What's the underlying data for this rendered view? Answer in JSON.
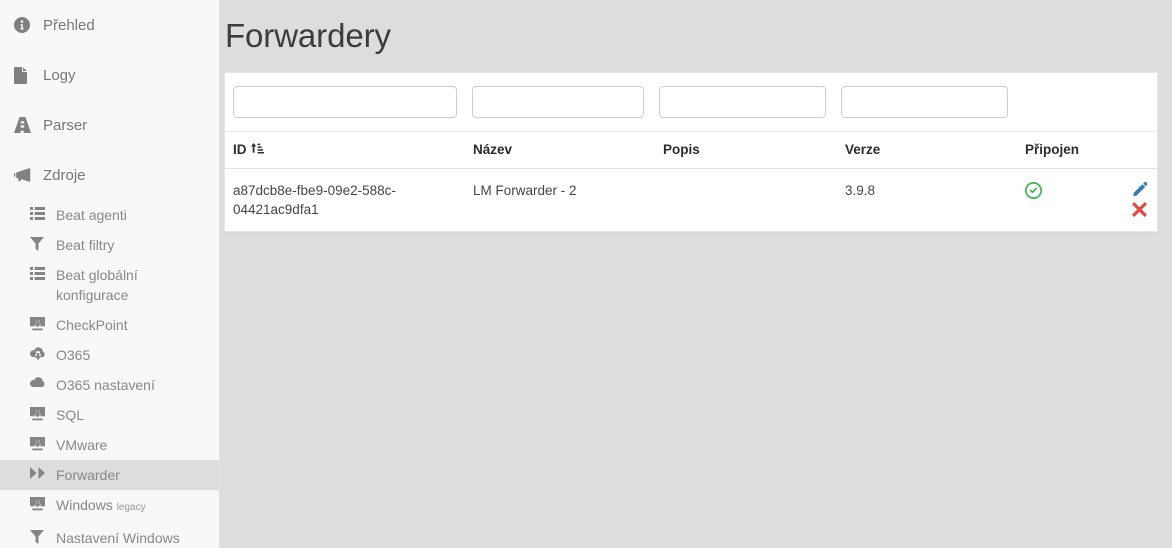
{
  "theme": {
    "page_bg": "#dddddd",
    "sidebar_bg": "#f8f8f8",
    "card_bg": "#ffffff",
    "active_item_bg": "#dddddd",
    "accent_edit": "#337ab7",
    "accent_delete": "#e8453c",
    "accent_connected": "#3ab54a",
    "title_color": "#3c3c3c"
  },
  "sidebar": {
    "top_items": [
      {
        "label": "Přehled",
        "icon": "info-circle-icon",
        "active": false
      },
      {
        "label": "Logy",
        "icon": "file-icon",
        "active": false
      },
      {
        "label": "Parser",
        "icon": "road-icon",
        "active": false
      },
      {
        "label": "Zdroje",
        "icon": "bullhorn-icon",
        "active": true
      }
    ],
    "sub_items": [
      {
        "label": "Beat agenti",
        "icon": "list-icon",
        "active": false,
        "sup": ""
      },
      {
        "label": "Beat filtry",
        "icon": "filter-icon",
        "active": false,
        "sup": ""
      },
      {
        "label": "Beat globální konfigurace",
        "icon": "list-icon",
        "active": false,
        "sup": ""
      },
      {
        "label": "CheckPoint",
        "icon": "desktop-download-icon",
        "active": false,
        "sup": ""
      },
      {
        "label": "O365",
        "icon": "cloud-download-icon",
        "active": false,
        "sup": ""
      },
      {
        "label": "O365 nastavení",
        "icon": "cloud-icon",
        "active": false,
        "sup": ""
      },
      {
        "label": "SQL",
        "icon": "desktop-download-icon",
        "active": false,
        "sup": ""
      },
      {
        "label": "VMware",
        "icon": "desktop-download-icon",
        "active": false,
        "sup": ""
      },
      {
        "label": "Forwarder",
        "icon": "fast-forward-icon",
        "active": true,
        "sup": ""
      },
      {
        "label": "Windows ",
        "icon": "desktop-download-icon",
        "active": false,
        "sup": "legacy"
      },
      {
        "label": "Nastavení Windows",
        "icon": "filter-icon",
        "active": false,
        "sup": ""
      }
    ]
  },
  "main": {
    "title": "Forwardery",
    "filters": [
      {
        "name": "filter-id",
        "value": "",
        "placeholder": ""
      },
      {
        "name": "filter-name",
        "value": "",
        "placeholder": ""
      },
      {
        "name": "filter-description",
        "value": "",
        "placeholder": ""
      },
      {
        "name": "filter-version",
        "value": "",
        "placeholder": ""
      }
    ],
    "table": {
      "columns": [
        {
          "key": "id",
          "label": "ID",
          "sorted": true,
          "sort_icon": "sort-amount-asc-icon"
        },
        {
          "key": "name",
          "label": "Název",
          "sorted": false,
          "sort_icon": ""
        },
        {
          "key": "description",
          "label": "Popis",
          "sorted": false,
          "sort_icon": ""
        },
        {
          "key": "version",
          "label": "Verze",
          "sorted": false,
          "sort_icon": ""
        },
        {
          "key": "connected",
          "label": "Připojen",
          "sorted": false,
          "sort_icon": ""
        },
        {
          "key": "actions",
          "label": "",
          "sorted": false,
          "sort_icon": ""
        }
      ],
      "rows": [
        {
          "id": "a87dcb8e-fbe9-09e2-588c-04421ac9dfa1",
          "name": "LM Forwarder - 2",
          "description": "",
          "version": "3.9.8",
          "connected": true,
          "connected_icon": "check-circle-icon",
          "actions": [
            {
              "name": "edit-row-button",
              "icon": "pencil-icon"
            },
            {
              "name": "delete-row-button",
              "icon": "times-icon"
            }
          ]
        }
      ]
    }
  }
}
